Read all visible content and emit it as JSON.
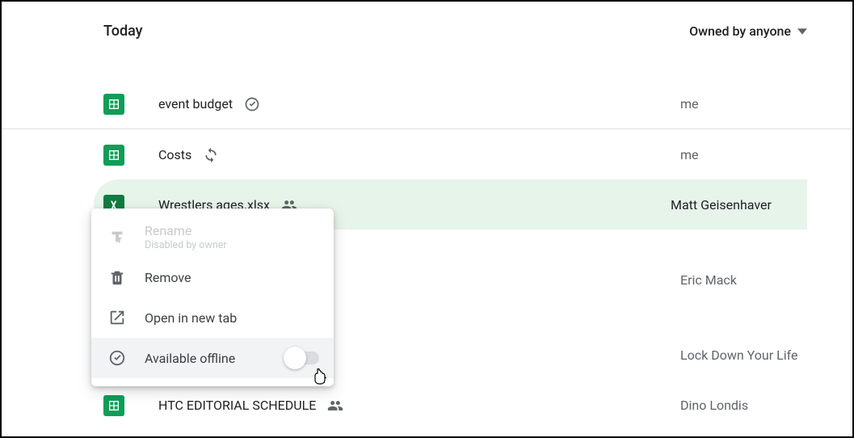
{
  "header": {
    "section_title": "Today",
    "filter_label": "Owned by anyone"
  },
  "files": [
    {
      "name": "event budget",
      "owner": "me",
      "icon": "sheets",
      "badge": "offline"
    },
    {
      "name": "Costs",
      "owner": "me",
      "icon": "sheets",
      "badge": "sync"
    },
    {
      "name": "Wrestlers ages.xlsx",
      "owner": "Matt Geisenhaver",
      "icon": "excel",
      "badge": "shared",
      "selected": true
    },
    {
      "name": "",
      "owner": "Eric Mack",
      "icon": "sheets"
    },
    {
      "name": "",
      "owner": "Lock Down Your Life",
      "icon": "sheets"
    },
    {
      "name": "HTC EDITORIAL SCHEDULE",
      "owner": "Dino Londis",
      "icon": "sheets",
      "badge": "shared"
    }
  ],
  "context_menu": {
    "rename_label": "Rename",
    "rename_sublabel": "Disabled by owner",
    "remove_label": "Remove",
    "open_new_tab_label": "Open in new tab",
    "available_offline_label": "Available offline",
    "offline_toggle_on": false
  }
}
